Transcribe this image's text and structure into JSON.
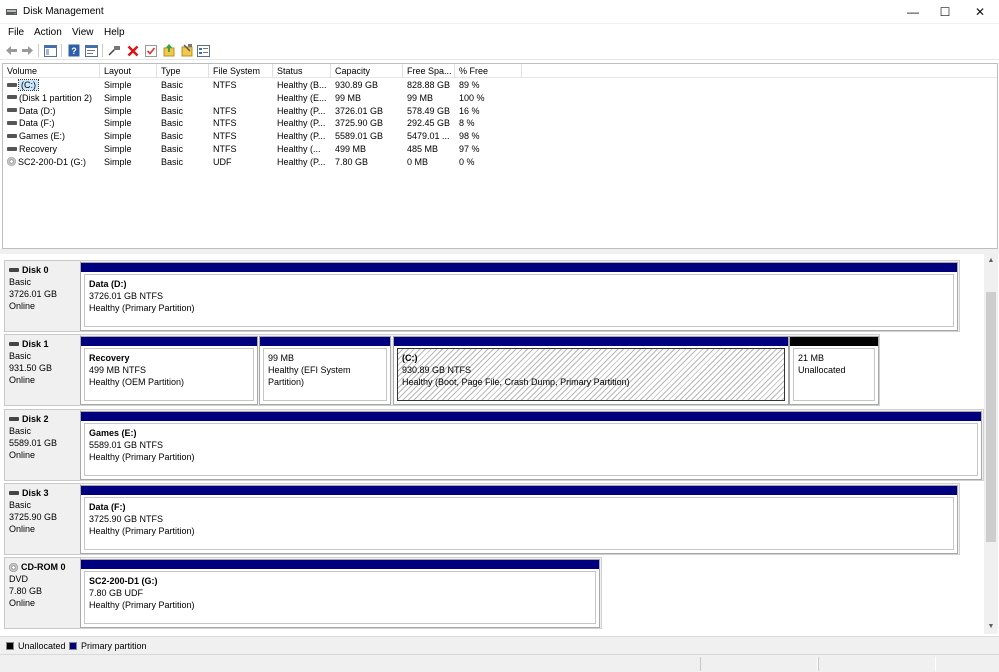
{
  "window": {
    "title": "Disk Management",
    "min_glyph": "—",
    "max_glyph": "☐",
    "close_glyph": "✕"
  },
  "menu": [
    "File",
    "Action",
    "View",
    "Help"
  ],
  "toolbar": [
    "back-icon",
    "forward-icon",
    "console-tree-icon",
    "help-icon",
    "properties-icon",
    "connect-icon",
    "delete-icon",
    "checkmark-icon",
    "rescan-icon",
    "import-icon",
    "settings-icon"
  ],
  "volume_list": {
    "columns": [
      "Volume",
      "Layout",
      "Type",
      "File System",
      "Status",
      "Capacity",
      "Free Spa...",
      "% Free"
    ],
    "rows": [
      {
        "volume": "(C:)",
        "layout": "Simple",
        "type": "Basic",
        "fs": "NTFS",
        "status": "Healthy (B...",
        "capacity": "930.89 GB",
        "free": "828.88 GB",
        "pct": "89 %",
        "icon": "disk",
        "selected": true
      },
      {
        "volume": "(Disk 1 partition 2)",
        "layout": "Simple",
        "type": "Basic",
        "fs": "",
        "status": "Healthy (E...",
        "capacity": "99 MB",
        "free": "99 MB",
        "pct": "100 %",
        "icon": "disk"
      },
      {
        "volume": "Data (D:)",
        "layout": "Simple",
        "type": "Basic",
        "fs": "NTFS",
        "status": "Healthy (P...",
        "capacity": "3726.01 GB",
        "free": "578.49 GB",
        "pct": "16 %",
        "icon": "disk"
      },
      {
        "volume": "Data (F:)",
        "layout": "Simple",
        "type": "Basic",
        "fs": "NTFS",
        "status": "Healthy (P...",
        "capacity": "3725.90 GB",
        "free": "292.45 GB",
        "pct": "8 %",
        "icon": "disk"
      },
      {
        "volume": "Games (E:)",
        "layout": "Simple",
        "type": "Basic",
        "fs": "NTFS",
        "status": "Healthy (P...",
        "capacity": "5589.01 GB",
        "free": "5479.01 ...",
        "pct": "98 %",
        "icon": "disk"
      },
      {
        "volume": "Recovery",
        "layout": "Simple",
        "type": "Basic",
        "fs": "NTFS",
        "status": "Healthy (...",
        "capacity": "499 MB",
        "free": "485 MB",
        "pct": "97 %",
        "icon": "disk"
      },
      {
        "volume": "SC2-200-D1 (G:)",
        "layout": "Simple",
        "type": "Basic",
        "fs": "UDF",
        "status": "Healthy (P...",
        "capacity": "7.80 GB",
        "free": "0 MB",
        "pct": "0 %",
        "icon": "cd"
      }
    ]
  },
  "disks": [
    {
      "name": "Disk 0",
      "type": "Basic",
      "size": "3726.01 GB",
      "state": "Online",
      "icon": "disk",
      "partitions": [
        {
          "name": "Data  (D:)",
          "size": "3726.01 GB NTFS",
          "status": "Healthy (Primary Partition)"
        }
      ]
    },
    {
      "name": "Disk 1",
      "type": "Basic",
      "size": "931.50 GB",
      "state": "Online",
      "icon": "disk",
      "partitions": [
        {
          "name": "Recovery",
          "size": "499 MB NTFS",
          "status": "Healthy (OEM Partition)"
        },
        {
          "name": "",
          "size": "99 MB",
          "status": "Healthy (EFI System Partition)"
        },
        {
          "name": "(C:)",
          "size": "930.89 GB NTFS",
          "status": "Healthy (Boot, Page File, Crash Dump, Primary Partition)",
          "selected": true
        },
        {
          "name": "",
          "size": "21 MB",
          "status": "Unallocated",
          "unallocated": true
        }
      ]
    },
    {
      "name": "Disk 2",
      "type": "Basic",
      "size": "5589.01 GB",
      "state": "Online",
      "icon": "disk",
      "partitions": [
        {
          "name": "Games  (E:)",
          "size": "5589.01 GB NTFS",
          "status": "Healthy (Primary Partition)"
        }
      ]
    },
    {
      "name": "Disk 3",
      "type": "Basic",
      "size": "3725.90 GB",
      "state": "Online",
      "icon": "disk",
      "partitions": [
        {
          "name": "Data  (F:)",
          "size": "3725.90 GB NTFS",
          "status": "Healthy (Primary Partition)"
        }
      ]
    },
    {
      "name": "CD-ROM 0",
      "type": "DVD",
      "size": "7.80 GB",
      "state": "Online",
      "icon": "cd",
      "partitions": [
        {
          "name": "SC2-200-D1  (G:)",
          "size": "7.80 GB UDF",
          "status": "Healthy (Primary Partition)"
        }
      ]
    }
  ],
  "legend": [
    {
      "label": "Unallocated",
      "color": "#000000"
    },
    {
      "label": "Primary partition",
      "color": "#00007f"
    }
  ],
  "colors": {
    "primary_bar": "#00007f",
    "unallocated_bar": "#000000",
    "selection": "#cce8ff"
  }
}
